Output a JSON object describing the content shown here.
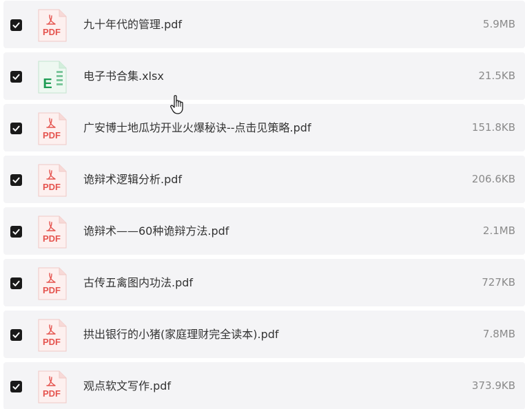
{
  "files": [
    {
      "name": "九十年代的管理.pdf",
      "size": "5.9MB",
      "type": "pdf",
      "checked": true,
      "icon": "pdf-file-icon"
    },
    {
      "name": "电子书合集.xlsx",
      "size": "21.5KB",
      "type": "xlsx",
      "checked": true,
      "icon": "excel-file-icon"
    },
    {
      "name": "广安博士地瓜坊开业火爆秘诀--点击见策略.pdf",
      "size": "151.8KB",
      "type": "pdf",
      "checked": true,
      "icon": "pdf-file-icon"
    },
    {
      "name": "诡辩术逻辑分析.pdf",
      "size": "206.6KB",
      "type": "pdf",
      "checked": true,
      "icon": "pdf-file-icon"
    },
    {
      "name": "诡辩术——60种诡辩方法.pdf",
      "size": "2.1MB",
      "type": "pdf",
      "checked": true,
      "icon": "pdf-file-icon"
    },
    {
      "name": "古传五禽图内功法.pdf",
      "size": "727KB",
      "type": "pdf",
      "checked": true,
      "icon": "pdf-file-icon"
    },
    {
      "name": "拱出银行的小猪(家庭理财完全读本).pdf",
      "size": "7.8MB",
      "type": "pdf",
      "checked": true,
      "icon": "pdf-file-icon"
    },
    {
      "name": "观点软文写作.pdf",
      "size": "373.9KB",
      "type": "pdf",
      "checked": true,
      "icon": "pdf-file-icon"
    }
  ],
  "labels": {
    "pdf": "PDF",
    "xlsx": "E"
  },
  "colors": {
    "row_bg": "#f4f4f6",
    "pdf_red": "#e5544f",
    "excel_green": "#1f9d55",
    "checkbox": "#1a1a1a"
  },
  "cursor": "hand-pointer-icon"
}
